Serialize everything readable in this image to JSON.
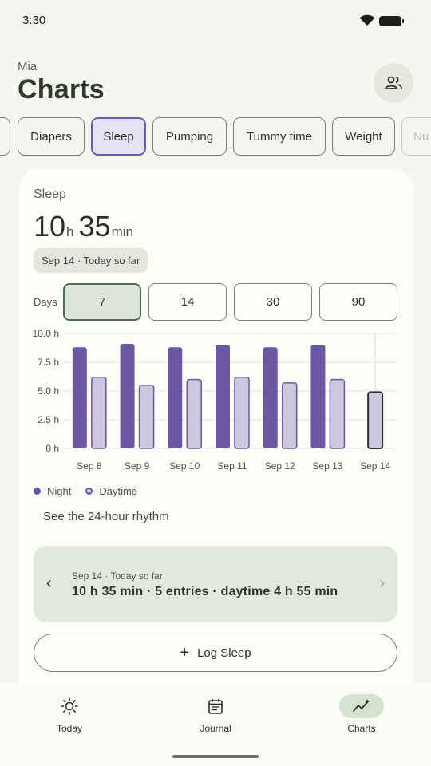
{
  "status": {
    "time": "3:30"
  },
  "header": {
    "child_name": "Mia",
    "title": "Charts"
  },
  "chips": [
    "",
    "Diapers",
    "Sleep",
    "Pumping",
    "Tummy time",
    "Weight",
    "Nu"
  ],
  "chips_selected": "Sleep",
  "card": {
    "title": "Sleep",
    "total_hours": "10",
    "hours_unit": "h",
    "total_minutes": "35",
    "minutes_unit": "min",
    "date_pill": "Sep 14 · Today so far",
    "days_label": "Days",
    "ranges": [
      "7",
      "14",
      "30",
      "90"
    ],
    "selected_range": "7",
    "legend": {
      "night": "Night",
      "daytime": "Daytime"
    },
    "rhythm_link": "See the 24-hour rhythm",
    "summary": {
      "date": "Sep 14 · Today so far",
      "main": "10 h 35 min · 5 entries · daytime 4 h 55 min"
    },
    "log_button": "Log Sleep"
  },
  "chart_data": {
    "type": "bar",
    "categories": [
      "Sep 8",
      "Sep 9",
      "Sep 10",
      "Sep 11",
      "Sep 12",
      "Sep 13",
      "Sep 14"
    ],
    "y_ticks": [
      "10.0 h",
      "7.5 h",
      "5.0 h",
      "2.5 h",
      "0 h"
    ],
    "ylim": [
      0,
      10
    ],
    "series": [
      {
        "name": "Night",
        "values": [
          8.8,
          9.1,
          8.8,
          9.0,
          8.8,
          9.0,
          null
        ],
        "color": "#6c57a4"
      },
      {
        "name": "Daytime",
        "values": [
          6.2,
          5.5,
          6.0,
          6.2,
          5.7,
          6.0,
          4.9
        ],
        "color": "#cdc8de"
      }
    ],
    "grid": true
  },
  "nav": [
    {
      "label": "Today",
      "icon": "sun-icon"
    },
    {
      "label": "Journal",
      "icon": "journal-icon"
    },
    {
      "label": "Charts",
      "icon": "chart-icon"
    }
  ],
  "nav_active": "Charts"
}
